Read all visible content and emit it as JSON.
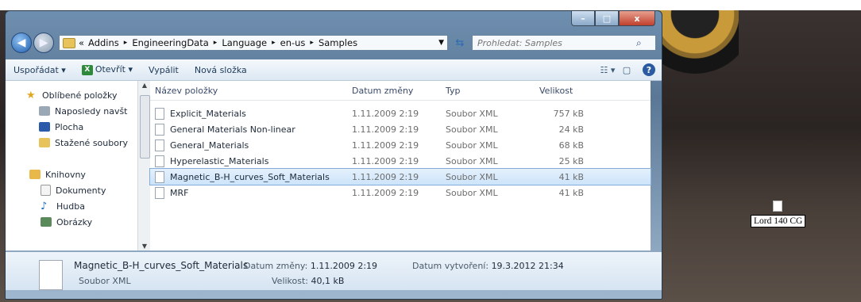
{
  "window": {
    "caption_buttons": {
      "minimize": "–",
      "maximize": "□",
      "close": "x"
    }
  },
  "address": {
    "prefix": "«",
    "crumbs": [
      "Addins",
      "EngineeringData",
      "Language",
      "en-us",
      "Samples"
    ],
    "separator": "▸"
  },
  "search": {
    "placeholder": "Prohledat: Samples"
  },
  "toolbar": {
    "organize": "Uspořádat ▾",
    "open": "Otevřít ▾",
    "burn": "Vypálit",
    "new_folder": "Nová složka"
  },
  "sidebar": {
    "favorites_title": "Oblíbené položky",
    "favorites": [
      "Naposledy navšt",
      "Plocha",
      "Stažené soubory"
    ],
    "libraries_title": "Knihovny",
    "libraries": [
      "Dokumenty",
      "Hudba",
      "Obrázky"
    ]
  },
  "list": {
    "columns": {
      "name": "Název položky",
      "date": "Datum změny",
      "type": "Typ",
      "size": "Velikost"
    },
    "rows": [
      {
        "name": "Explicit_Materials",
        "date": "1.11.2009 2:19",
        "type": "Soubor XML",
        "size": "757 kB"
      },
      {
        "name": "General Materials Non-linear",
        "date": "1.11.2009 2:19",
        "type": "Soubor XML",
        "size": "24 kB"
      },
      {
        "name": "General_Materials",
        "date": "1.11.2009 2:19",
        "type": "Soubor XML",
        "size": "68 kB"
      },
      {
        "name": "Hyperelastic_Materials",
        "date": "1.11.2009 2:19",
        "type": "Soubor XML",
        "size": "25 kB"
      },
      {
        "name": "Magnetic_B-H_curves_Soft_Materials",
        "date": "1.11.2009 2:19",
        "type": "Soubor XML",
        "size": "41 kB"
      },
      {
        "name": "MRF",
        "date": "1.11.2009 2:19",
        "type": "Soubor XML",
        "size": "41 kB"
      }
    ],
    "selected_index": 4
  },
  "details": {
    "name": "Magnetic_B-H_curves_Soft_Materials",
    "type": "Soubor XML",
    "modified_label": "Datum změny:",
    "modified_value": "1.11.2009 2:19",
    "created_label": "Datum vytvoření:",
    "created_value": "19.3.2012 21:34",
    "size_label": "Velikost:",
    "size_value": "40,1 kB"
  },
  "desktop": {
    "file_label": "Lord 140 CG"
  },
  "colors": {
    "selection": "#cde4fa",
    "selection_border": "#84acdd",
    "folder": "#e8c25a"
  }
}
